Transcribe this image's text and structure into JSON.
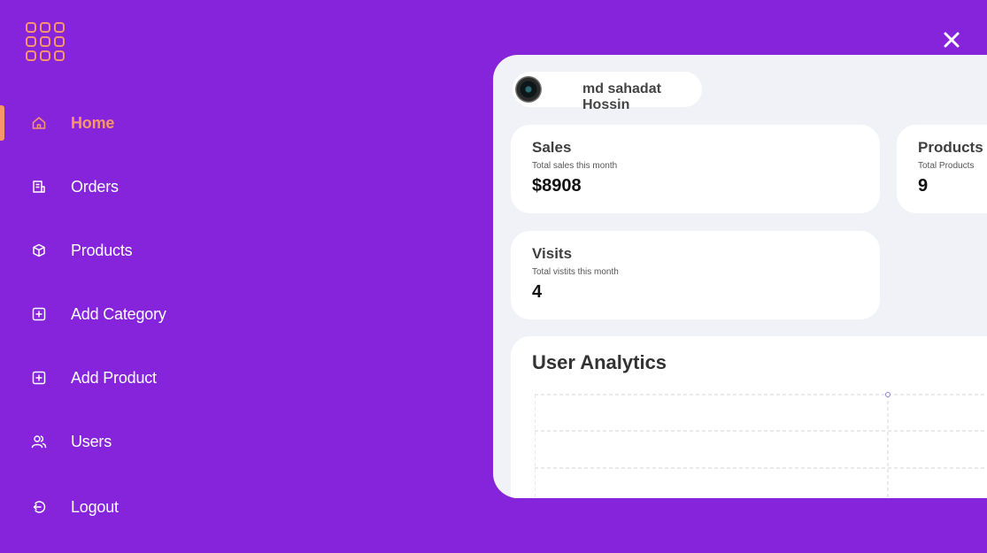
{
  "sidebar": {
    "items": [
      {
        "label": "Home",
        "icon": "home-icon",
        "active": true
      },
      {
        "label": "Orders",
        "icon": "orders-icon"
      },
      {
        "label": "Products",
        "icon": "box-icon"
      },
      {
        "label": "Add Category",
        "icon": "plus-square-icon"
      },
      {
        "label": "Add Product",
        "icon": "plus-square-icon"
      },
      {
        "label": "Users",
        "icon": "users-icon"
      },
      {
        "label": "Logout",
        "icon": "logout-icon"
      }
    ]
  },
  "header": {
    "close_icon": "close-icon"
  },
  "profile": {
    "name": "md sahadat Hossin"
  },
  "stats": {
    "sales": {
      "title": "Sales",
      "subtitle": "Total sales this month",
      "value": "$8908"
    },
    "products": {
      "title": "Products",
      "subtitle": "Total Products",
      "value": "9"
    },
    "visits": {
      "title": "Visits",
      "subtitle": "Total vistits this month",
      "value": "4"
    }
  },
  "analytics": {
    "title": "User Analytics"
  },
  "colors": {
    "background": "#8624DB",
    "accent": "#F9956A",
    "panel": "#F1F2F7",
    "card": "#ffffff"
  }
}
